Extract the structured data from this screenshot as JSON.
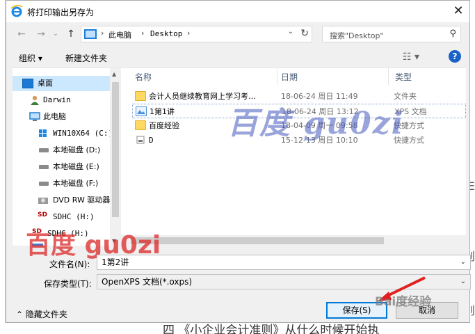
{
  "window": {
    "title": "将打印输出另存为",
    "close": "✕"
  },
  "address": {
    "back": "←",
    "forward": "→",
    "recent": "⌄",
    "up": "↑",
    "segments": [
      "此电脑",
      "Desktop"
    ],
    "separator": "›",
    "dropdown": "⌄",
    "refresh": "↻"
  },
  "search": {
    "placeholder": "搜索\"Desktop\"",
    "icon": "⚲"
  },
  "toolbar": {
    "organize": "组织 ▾",
    "new_folder": "新建文件夹",
    "view": "☷ ▾",
    "help": "?"
  },
  "nav": {
    "items": [
      {
        "label": "桌面",
        "icon": "desktop-icon",
        "selected": true
      },
      {
        "label": "Darwin",
        "icon": "user-icon"
      },
      {
        "label": "此电脑",
        "icon": "computer-icon"
      },
      {
        "label": "WIN10X64 (C:)",
        "icon": "windows-drive-icon"
      },
      {
        "label": "本地磁盘 (D:)",
        "icon": "drive-icon"
      },
      {
        "label": "本地磁盘 (E:)",
        "icon": "drive-icon"
      },
      {
        "label": "本地磁盘 (F:)",
        "icon": "drive-icon"
      },
      {
        "label": "DVD RW 驱动器",
        "icon": "dvd-icon"
      },
      {
        "label": "SDHC (H:)",
        "icon": "sd-icon"
      },
      {
        "label": "SDHC (H:)",
        "icon": "sd-icon"
      },
      {
        "label": "…",
        "icon": "network-icon"
      }
    ]
  },
  "columns": {
    "name": "名称",
    "date": "日期",
    "type": "类型"
  },
  "files": [
    {
      "name": "会计人员继续教育网上学习考…",
      "date": "18-06-24 周日 11:49",
      "type": "文件夹",
      "icon": "folder-icon"
    },
    {
      "name": "1第1讲",
      "date": "18-06-24 周日 13:12",
      "type": "XPS 文档",
      "icon": "xps-icon",
      "selected": true
    },
    {
      "name": "百度经验",
      "date": "18-04-09 周一 09:58",
      "type": "快捷方式",
      "icon": "folder-shortcut-icon"
    },
    {
      "name": "D",
      "date": "15-12-13 周日 10:10",
      "type": "快捷方式",
      "icon": "drive-shortcut-icon"
    }
  ],
  "filename": {
    "label": "文件名(N):",
    "value": "1第2讲",
    "dropdown": "⌄"
  },
  "filetype": {
    "label": "保存类型(T):",
    "value": "OpenXPS 文档(*.oxps)",
    "dropdown": "⌄"
  },
  "footer": {
    "hide_folders": "⌃  隐藏文件夹",
    "save": "保存(S)",
    "cancel": "取消"
  },
  "watermarks": {
    "center": "百度 gu0zi",
    "left": "百度 gu0zi",
    "bottom_right": "Bai度经验"
  },
  "background": {
    "bottom_text": "四 《小企业会计准则》从什么时候开始执",
    "right_chars": [
      "E",
      "则",
      "则"
    ]
  }
}
